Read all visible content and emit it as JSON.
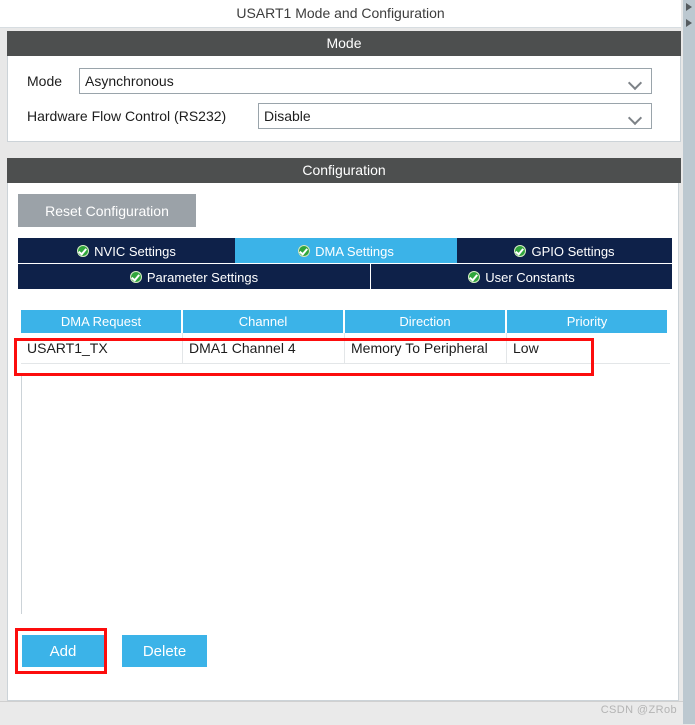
{
  "window": {
    "title": "USART1 Mode and Configuration"
  },
  "scrollbar": {
    "arrow_up_icon": "chevron-right-icon",
    "arrow_down_icon": "chevron-right-icon"
  },
  "mode_section": {
    "header": "Mode",
    "fields": [
      {
        "label": "Mode",
        "value": "Asynchronous",
        "arrow_icon": "chevron-down-icon"
      },
      {
        "label": "Hardware Flow Control (RS232)",
        "value": "Disable",
        "arrow_icon": "chevron-down-icon"
      }
    ]
  },
  "configuration_section": {
    "header": "Configuration",
    "reset_button": "Reset Configuration",
    "tabs": [
      {
        "label": "NVIC Settings",
        "active": false,
        "icon": "green-check-icon"
      },
      {
        "label": "DMA Settings",
        "active": true,
        "icon": "green-check-icon"
      },
      {
        "label": "GPIO Settings",
        "active": false,
        "icon": "green-check-icon"
      },
      {
        "label": "Parameter Settings",
        "active": false,
        "icon": "green-check-icon"
      },
      {
        "label": "User Constants",
        "active": false,
        "icon": "green-check-icon"
      }
    ],
    "table": {
      "columns": [
        "DMA Request",
        "Channel",
        "Direction",
        "Priority"
      ],
      "rows": [
        {
          "dma_request": "USART1_TX",
          "channel": "DMA1 Channel 4",
          "direction": "Memory To Peripheral",
          "priority": "Low"
        }
      ]
    },
    "buttons": {
      "add": "Add",
      "delete": "Delete"
    }
  },
  "annotations": {
    "row_highlight_color": "#fc0d0d",
    "add_highlight_color": "#fc0d0d"
  },
  "footer": {
    "watermark": "CSDN @ZRob"
  },
  "colors": {
    "section_header_bg": "#4d4f4f",
    "tab_bg": "#0e2149",
    "tab_active_bg": "#3bb3e8",
    "accent_blue": "#3bb3e8",
    "reset_button_bg": "#9ba2a8",
    "check_green": "#30a63c"
  }
}
